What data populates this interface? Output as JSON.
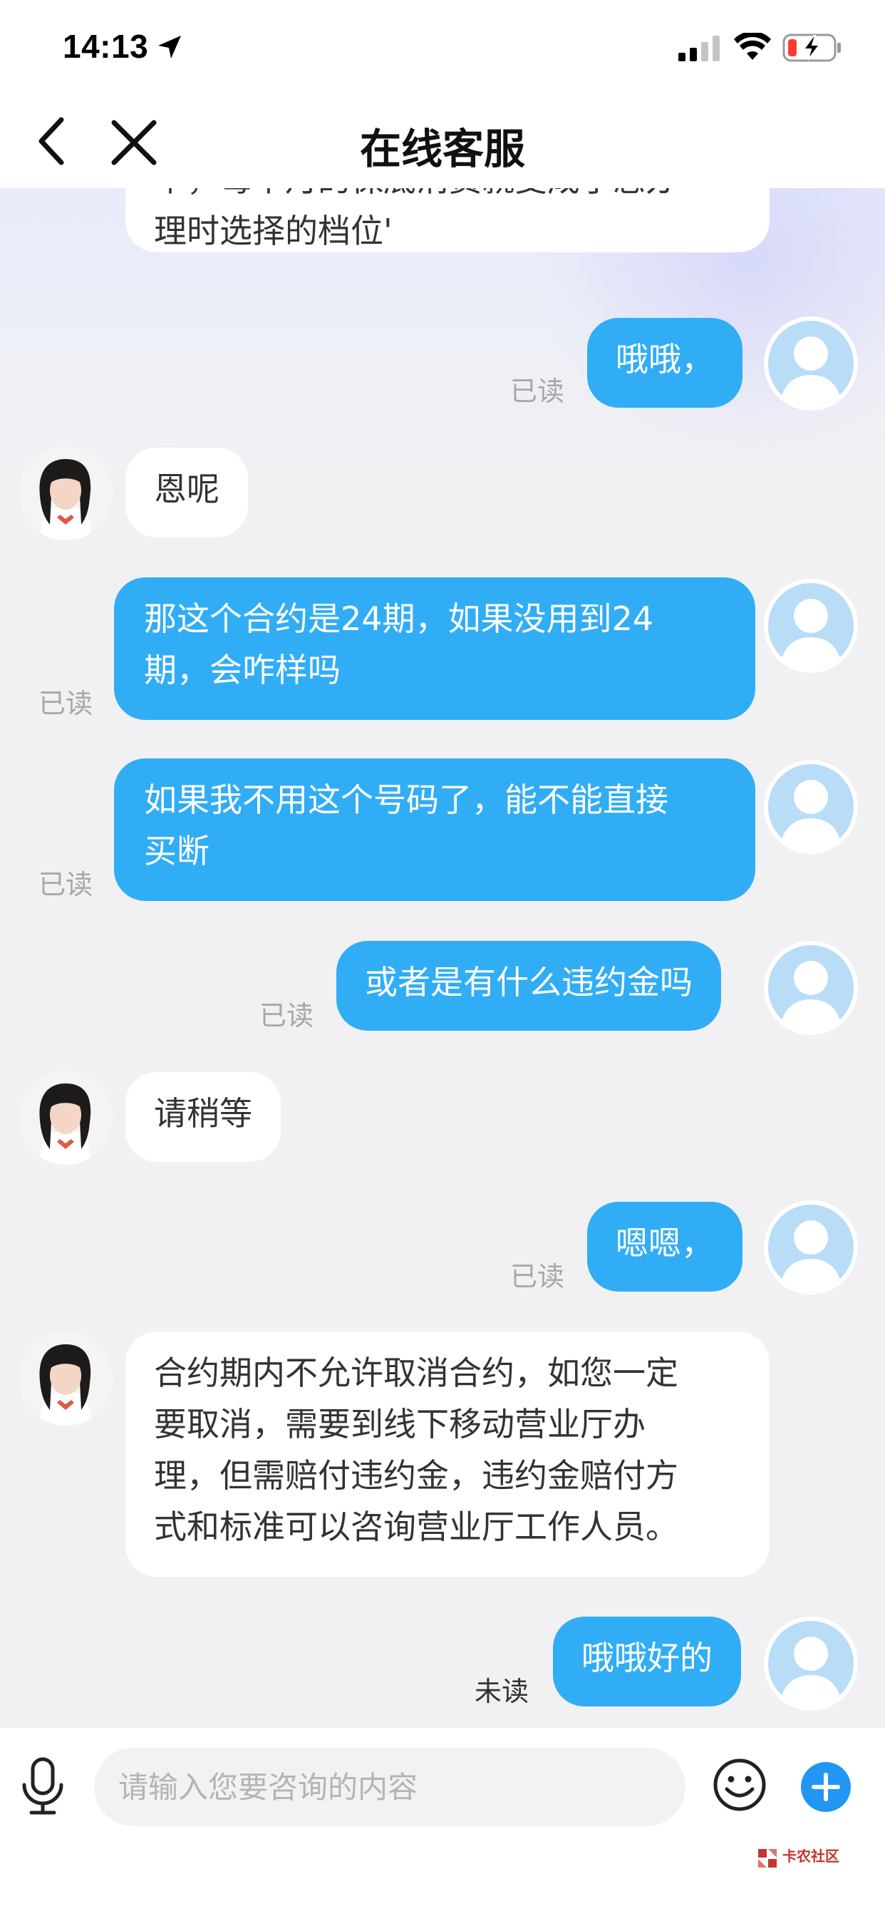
{
  "status_bar": {
    "time": "14:13"
  },
  "nav": {
    "title": "在线客服"
  },
  "messages": [
    {
      "sender": "agent",
      "lines": [
        "个，每个月的保底消费就变成了您办",
        "理时选择的档位'"
      ]
    },
    {
      "sender": "user",
      "lines": [
        "哦哦，"
      ],
      "status": "已读"
    },
    {
      "sender": "agent",
      "lines": [
        "恩呢"
      ]
    },
    {
      "sender": "user",
      "lines": [
        "那这个合约是24期，如果没用到24",
        "期，会咋样吗"
      ],
      "status": "已读"
    },
    {
      "sender": "user",
      "lines": [
        "如果我不用这个号码了，能不能直接",
        "买断"
      ],
      "status": "已读"
    },
    {
      "sender": "user",
      "lines": [
        "或者是有什么违约金吗"
      ],
      "status": "已读"
    },
    {
      "sender": "agent",
      "lines": [
        "请稍等"
      ]
    },
    {
      "sender": "user",
      "lines": [
        "嗯嗯，"
      ],
      "status": "已读"
    },
    {
      "sender": "agent",
      "lines": [
        "合约期内不允许取消合约，如您一定",
        "要取消，需要到线下移动营业厅办",
        "理，但需赔付违约金，违约金赔付方",
        "式和标准可以咨询营业厅工作人员。"
      ]
    },
    {
      "sender": "user",
      "lines": [
        "哦哦好的"
      ],
      "status": "未读"
    }
  ],
  "input": {
    "placeholder": "请输入您要咨询的内容"
  },
  "watermark": {
    "text": "卡农社区"
  },
  "colors": {
    "user_bubble": "#31adf5",
    "agent_bubble": "#ffffff",
    "accent": "#2196f3"
  },
  "icons": [
    "back-icon",
    "close-icon",
    "microphone-icon",
    "emoji-icon",
    "plus-icon"
  ]
}
